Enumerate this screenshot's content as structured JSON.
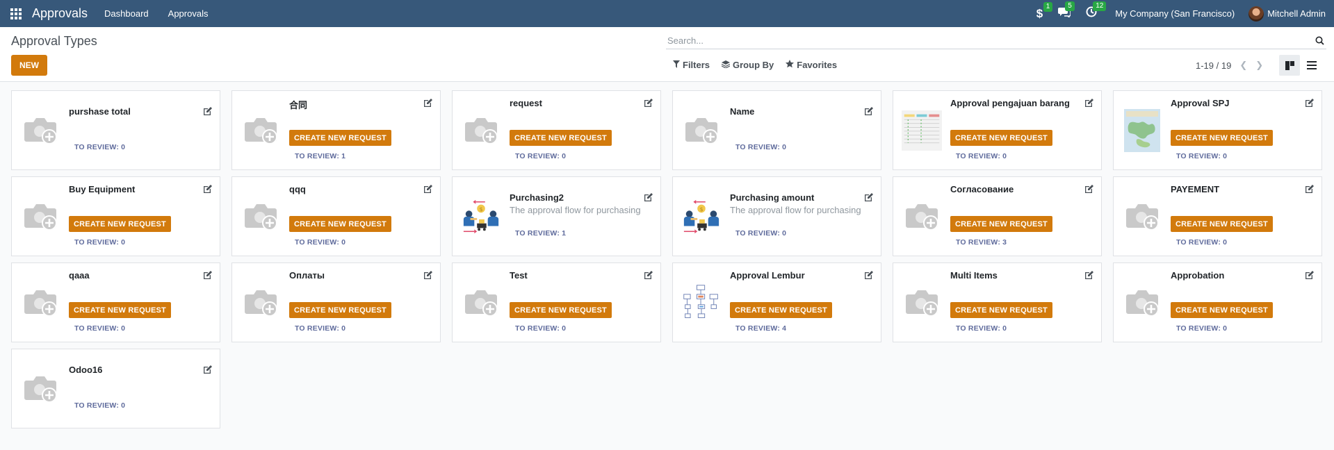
{
  "navbar": {
    "brand": "Approvals",
    "links": [
      "Dashboard",
      "Approvals"
    ],
    "systray": [
      {
        "icon": "dollar-icon",
        "glyph": "$",
        "badge": "1"
      },
      {
        "icon": "chat-icon",
        "glyph": "💬",
        "badge": "5"
      },
      {
        "icon": "clock-icon",
        "glyph": "◷",
        "badge": "12"
      }
    ],
    "company": "My Company (San Francisco)",
    "user": "Mitchell Admin"
  },
  "control": {
    "title": "Approval Types",
    "new_label": "NEW",
    "search_placeholder": "Search...",
    "filters_label": "Filters",
    "groupby_label": "Group By",
    "favorites_label": "Favorites",
    "pager": "1-19 / 19"
  },
  "cards": [
    {
      "title": "purshase total",
      "image": "camera-placeholder",
      "desc": "",
      "button": "",
      "review": "TO REVIEW: 0"
    },
    {
      "title": "合同",
      "image": "camera-placeholder",
      "desc": "",
      "button": "CREATE NEW REQUEST",
      "review": "TO REVIEW: 1"
    },
    {
      "title": "request",
      "image": "camera-placeholder",
      "desc": "",
      "button": "CREATE NEW REQUEST",
      "review": "TO REVIEW: 0"
    },
    {
      "title": "Name",
      "image": "camera-placeholder",
      "desc": "",
      "button": "",
      "review": "TO REVIEW: 0"
    },
    {
      "title": "Approval pengajuan barang",
      "image": "table-thumbnail",
      "desc": "",
      "button": "CREATE NEW REQUEST",
      "review": "TO REVIEW: 0"
    },
    {
      "title": "Approval SPJ",
      "image": "map-thumbnail",
      "desc": "",
      "button": "CREATE NEW REQUEST",
      "review": "TO REVIEW: 0"
    },
    {
      "title": "Buy Equipment",
      "image": "camera-placeholder",
      "desc": "",
      "button": "CREATE NEW REQUEST",
      "review": "TO REVIEW: 0"
    },
    {
      "title": "qqq",
      "image": "camera-placeholder",
      "desc": "",
      "button": "CREATE NEW REQUEST",
      "review": "TO REVIEW: 0"
    },
    {
      "title": "Purchasing2",
      "image": "purchasing-illustration",
      "desc": "The approval flow for purchasing",
      "button": "",
      "review": "TO REVIEW: 1"
    },
    {
      "title": "Purchasing amount",
      "image": "purchasing-illustration",
      "desc": "The approval flow for purchasing",
      "button": "",
      "review": "TO REVIEW: 0"
    },
    {
      "title": "Согласование",
      "image": "camera-placeholder",
      "desc": "",
      "button": "CREATE NEW REQUEST",
      "review": "TO REVIEW: 3"
    },
    {
      "title": "PAYEMENT",
      "image": "camera-placeholder",
      "desc": "",
      "button": "CREATE NEW REQUEST",
      "review": "TO REVIEW: 0"
    },
    {
      "title": "qaaa",
      "image": "camera-placeholder",
      "desc": "",
      "button": "CREATE NEW REQUEST",
      "review": "TO REVIEW: 0"
    },
    {
      "title": "Оплаты",
      "image": "camera-placeholder",
      "desc": "",
      "button": "CREATE NEW REQUEST",
      "review": "TO REVIEW: 0"
    },
    {
      "title": "Test",
      "image": "camera-placeholder",
      "desc": "",
      "button": "CREATE NEW REQUEST",
      "review": "TO REVIEW: 0"
    },
    {
      "title": "Approval Lembur",
      "image": "flowchart-thumbnail",
      "desc": "",
      "button": "CREATE NEW REQUEST",
      "review": "TO REVIEW: 4"
    },
    {
      "title": "Multi Items",
      "image": "camera-placeholder",
      "desc": "",
      "button": "CREATE NEW REQUEST",
      "review": "TO REVIEW: 0"
    },
    {
      "title": "Approbation",
      "image": "camera-placeholder",
      "desc": "",
      "button": "CREATE NEW REQUEST",
      "review": "TO REVIEW: 0"
    },
    {
      "title": "Odoo16",
      "image": "camera-placeholder",
      "desc": "",
      "button": "",
      "review": "TO REVIEW: 0"
    }
  ],
  "colors": {
    "navbar": "#37587a",
    "primary_button": "#d27a0c",
    "review_text": "#5f6b9c"
  }
}
